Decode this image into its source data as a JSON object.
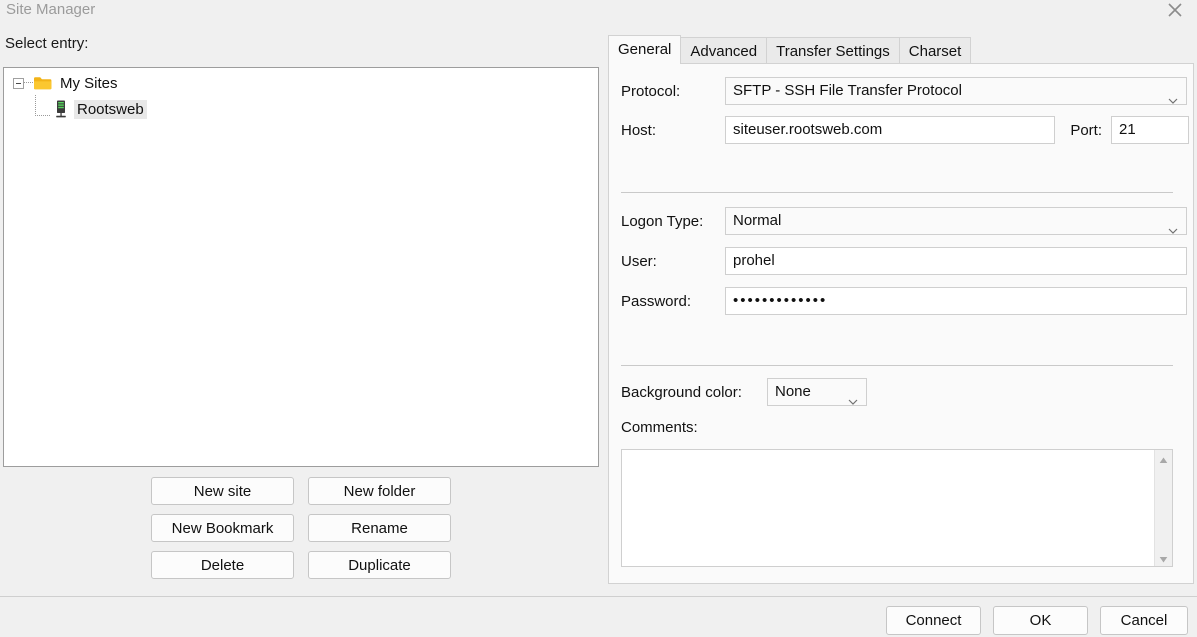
{
  "window": {
    "title": "Site Manager",
    "close_icon": "close-x-icon"
  },
  "left_pane": {
    "select_entry_label": "Select entry:",
    "tree": {
      "root": {
        "label": "My Sites",
        "icon": "folder-icon",
        "expanded": true,
        "expander_glyph": "minus"
      },
      "children": [
        {
          "label": "Rootsweb",
          "icon": "server-icon",
          "selected": true
        }
      ]
    },
    "buttons": [
      {
        "label": "New site"
      },
      {
        "label": "New folder"
      },
      {
        "label": "New Bookmark"
      },
      {
        "label": "Rename"
      },
      {
        "label": "Delete"
      },
      {
        "label": "Duplicate"
      }
    ]
  },
  "right_pane": {
    "tabs": [
      {
        "label": "General",
        "active": true
      },
      {
        "label": "Advanced",
        "active": false
      },
      {
        "label": "Transfer Settings",
        "active": false
      },
      {
        "label": "Charset",
        "active": false
      }
    ],
    "general": {
      "protocol_label": "Protocol:",
      "protocol_value": "SFTP - SSH File Transfer Protocol",
      "host_label": "Host:",
      "host_value": "siteuser.rootsweb.com",
      "port_label": "Port:",
      "port_value": "21",
      "logon_type_label": "Logon Type:",
      "logon_type_value": "Normal",
      "user_label": "User:",
      "user_value": "prohel",
      "password_label": "Password:",
      "password_value": "•••••••••••••",
      "background_color_label": "Background color:",
      "background_color_value": "None",
      "comments_label": "Comments:",
      "comments_value": "",
      "comments_placeholder": ""
    }
  },
  "footer": {
    "connect_label": "Connect",
    "ok_label": "OK",
    "cancel_label": "Cancel"
  },
  "colors": {
    "window_bg": "#f0f0f0",
    "panel_bg": "#fafafa",
    "field_bg": "#ffffff",
    "folder_icon": "#f5b81c",
    "server_led": "#4caf50",
    "selection": "#e8e8e8",
    "title_text": "#9b9b9b"
  }
}
